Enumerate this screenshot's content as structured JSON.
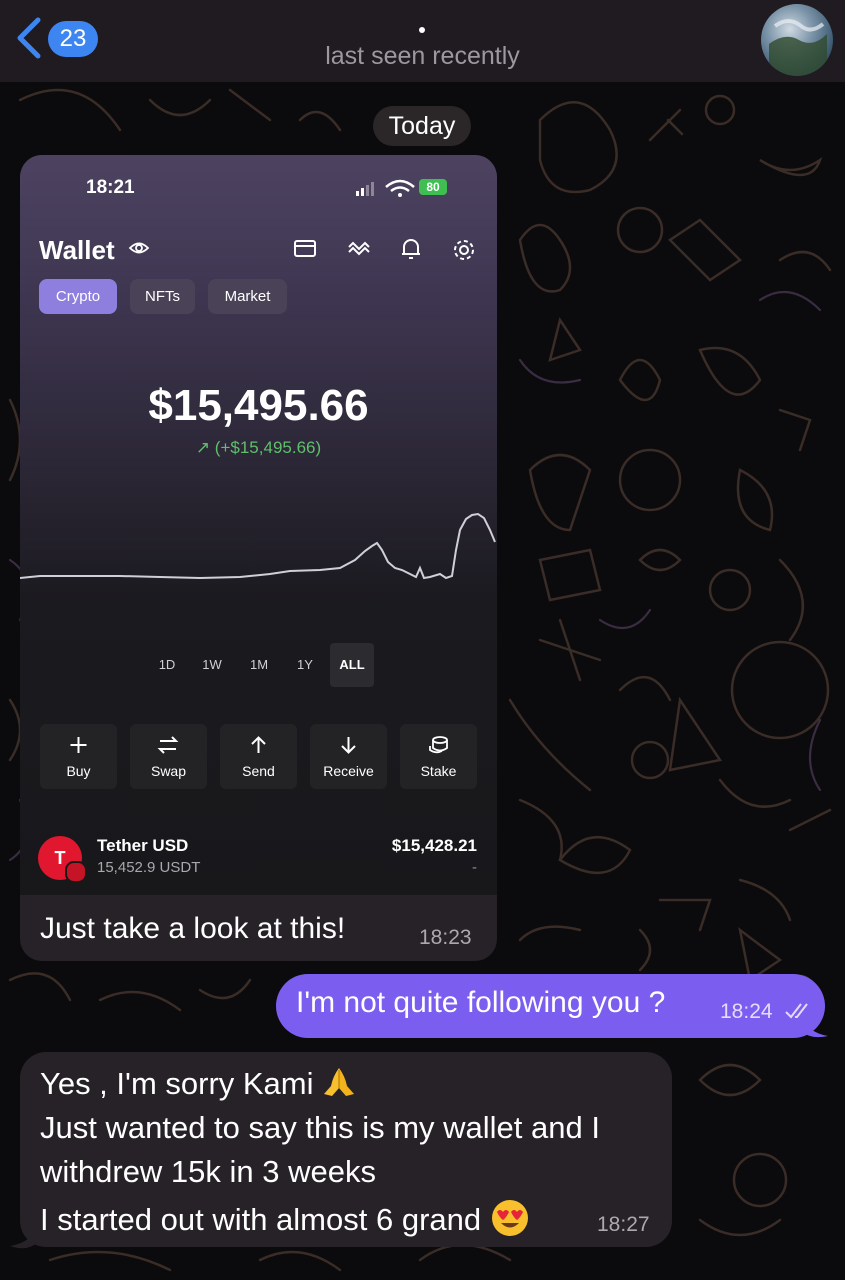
{
  "header": {
    "unread_count": "23",
    "status": "last seen recently"
  },
  "date_separator": "Today",
  "messages": [
    {
      "direction": "incoming",
      "attachment": {
        "status_bar": {
          "time": "18:21",
          "battery": "80"
        },
        "wallet": {
          "title": "Wallet",
          "tabs": [
            "Crypto",
            "NFTs",
            "Market"
          ],
          "active_tab": "Crypto",
          "balance": "$15,495.66",
          "change": "↗ (+$15,495.66)",
          "ranges": [
            "1D",
            "1W",
            "1M",
            "1Y",
            "ALL"
          ],
          "active_range": "ALL",
          "actions": [
            "Buy",
            "Swap",
            "Send",
            "Receive",
            "Stake"
          ],
          "token": {
            "name": "Tether USD",
            "amount": "15,452.9 USDT",
            "value": "$15,428.21",
            "change": "-"
          }
        }
      },
      "text": "Just take a look at this!",
      "time": "18:23"
    },
    {
      "direction": "outgoing",
      "text": "I'm not quite following you ?",
      "time": "18:24"
    },
    {
      "direction": "incoming",
      "lines": [
        "Yes , I'm sorry Kami",
        "Just wanted to say this is my wallet and I",
        "withdrew 15k in 3 weeks",
        "I started out with almost 6 grand"
      ],
      "time": "18:27"
    }
  ],
  "colors": {
    "accent": "#7b5ef0",
    "badge": "#3d86f2",
    "bubble_in": "#262227",
    "positive": "#5fbf6c",
    "tether": "#e1172f"
  }
}
